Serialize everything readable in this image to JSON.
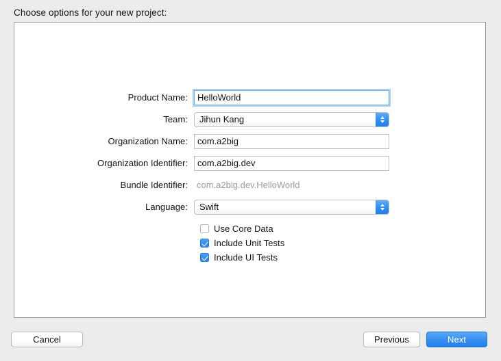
{
  "dialog": {
    "prompt": "Choose options for your new project:"
  },
  "form": {
    "fields": [
      {
        "label": "Product Name:",
        "value": "HelloWorld",
        "type": "text",
        "focused": true
      },
      {
        "label": "Team:",
        "value": "Jihun Kang",
        "type": "select"
      },
      {
        "label": "Organization Name:",
        "value": "com.a2big",
        "type": "text"
      },
      {
        "label": "Organization Identifier:",
        "value": "com.a2big.dev",
        "type": "text"
      },
      {
        "label": "Bundle Identifier:",
        "value": "com.a2big.dev.HelloWorld",
        "type": "static"
      },
      {
        "label": "Language:",
        "value": "Swift",
        "type": "select"
      }
    ]
  },
  "checkboxes": [
    {
      "label": "Use Core Data",
      "checked": false
    },
    {
      "label": "Include Unit Tests",
      "checked": true
    },
    {
      "label": "Include UI Tests",
      "checked": true
    }
  ],
  "buttons": {
    "cancel": "Cancel",
    "previous": "Previous",
    "next": "Next"
  },
  "colors": {
    "accent": "#2b85ec",
    "window_bg": "#ececec",
    "panel_bg": "#ffffff",
    "focus_ring": "#a8cff0",
    "disabled_text": "#9a9a9a"
  }
}
